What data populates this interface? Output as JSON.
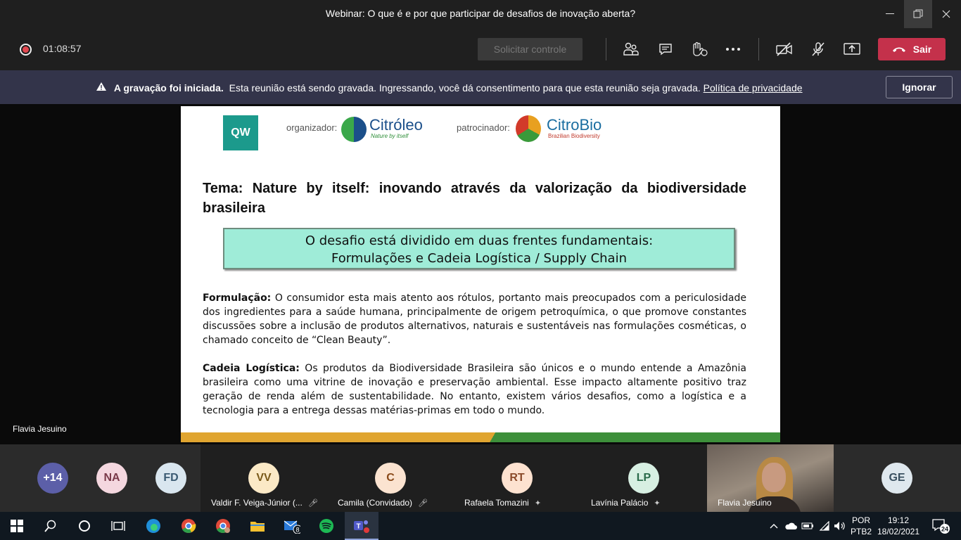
{
  "window": {
    "title": "Webinar: O que é e por que participar de desafios de inovação aberta?"
  },
  "controls": {
    "timer": "01:08:57",
    "request_control": "Solicitar controle",
    "leave_label": "Sair",
    "leave_color": "#c4314b"
  },
  "banner": {
    "bold": "A gravação foi iniciada.",
    "text": "Esta reunião está sendo gravada. Ingressando, você dá consentimento para que esta reunião seja gravada.",
    "link": "Política de privacidade",
    "dismiss": "Ignorar"
  },
  "stage": {
    "speaker_name": "Flavia Jesuino"
  },
  "slide": {
    "qw_logo": "QW",
    "organizer_label": "organizador:",
    "organizer_name": "Citróleo",
    "organizer_tagline": "Nature by itself",
    "sponsor_label": "patrocinador:",
    "sponsor_name": "CitroBio",
    "sponsor_tagline": "Brazilian Biodiversity",
    "theme": "Tema: Nature by itself: inovando através da valorização da biodiversidade brasileira",
    "box_line1": "O desafio está dividido em duas frentes fundamentais:",
    "box_line2": "Formulações e Cadeia Logística / Supply Chain",
    "p1_label": "Formulação:",
    "p1_text": " O consumidor esta mais atento aos rótulos, portanto mais preocupados com a periculosidade dos ingredientes para a saúde humana, principalmente de origem petroquímica, o que promove constantes discussões sobre a inclusão de produtos alternativos, naturais e sustentáveis nas formulações cosméticas, o chamado conceito de “Clean Beauty”.",
    "p2_label": "Cadeia Logística:",
    "p2_text": " Os produtos da Biodiversidade Brasileira são únicos e o mundo entende a Amazônia brasileira como uma vitrine de inovação e preservação ambiental. Esse impacto altamente positivo traz geração de renda além de sustentabilidade. No entanto, existem vários desafios, como a logística e a tecnologia para a entrega dessas matérias-primas em todo o mundo."
  },
  "participants": [
    {
      "initials": "+14",
      "bg": "#5c5fa8",
      "fg": "#ffffff"
    },
    {
      "initials": "NA",
      "bg": "#f4d7df",
      "fg": "#7a3a4a"
    },
    {
      "initials": "FD",
      "bg": "#d9e6ef",
      "fg": "#3b5b73"
    },
    {
      "initials": "VV",
      "name": "Valdir F. Veiga-Júnior (...",
      "bg": "#fbe9c6",
      "fg": "#7a5a1a"
    },
    {
      "initials": "C",
      "name": "Camila (Convidado)",
      "bg": "#fbe3d0",
      "fg": "#8a4a1a"
    },
    {
      "initials": "RT",
      "name": "Rafaela Tomazini",
      "bg": "#fde2d0",
      "fg": "#8a4a2a"
    },
    {
      "initials": "LP",
      "name": "Lavínia Palácio",
      "bg": "#d7efe2",
      "fg": "#2a6a4a"
    },
    {
      "name": "Flavia Jesuino"
    },
    {
      "initials": "GE",
      "bg": "#dfe8ee",
      "fg": "#3a5060"
    }
  ],
  "taskbar": {
    "lang": "POR",
    "layout": "PTB2",
    "time": "19:12",
    "date": "18/02/2021",
    "mail_badge": "8",
    "notif_count": "24"
  }
}
